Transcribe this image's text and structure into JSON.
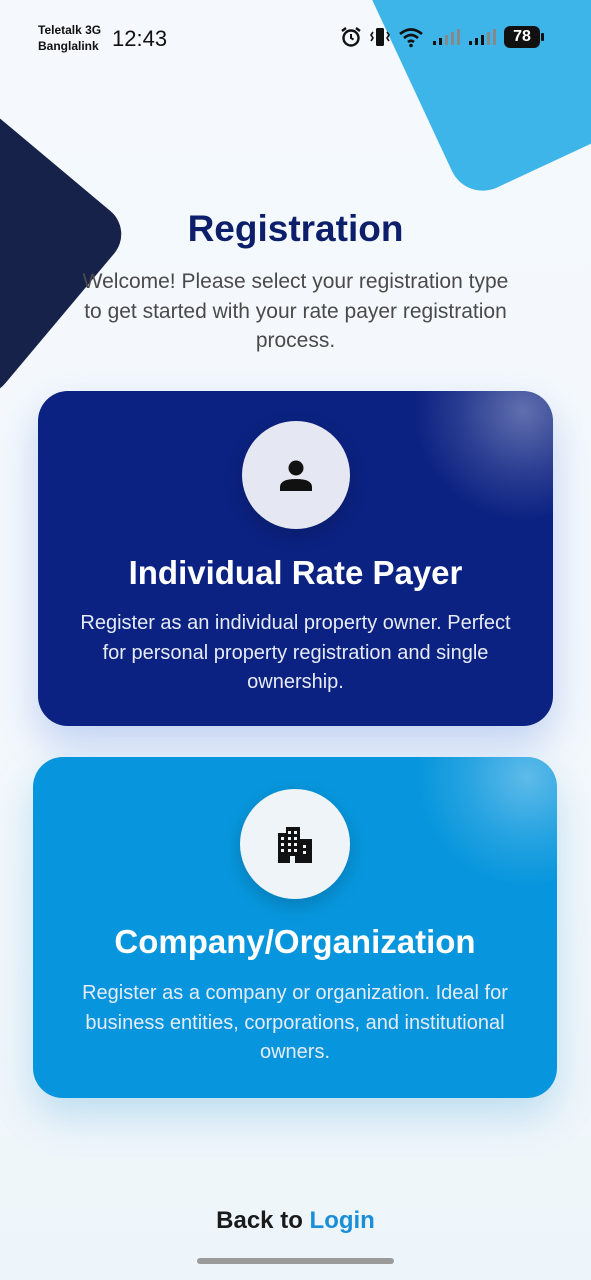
{
  "status_bar": {
    "carrier_line1": "Teletalk 3G",
    "carrier_line2": "Banglalink",
    "time": "12:43",
    "battery": "78",
    "icons": [
      "alarm-icon",
      "vibrate-icon",
      "wifi-icon",
      "signal-icon",
      "signal-icon",
      "battery-icon"
    ]
  },
  "header": {
    "title": "Registration",
    "subtitle": "Welcome! Please select your registration type to get started with your rate payer registration process."
  },
  "options": [
    {
      "icon": "person-icon",
      "title": "Individual Rate Payer",
      "description": "Register as an individual property owner. Perfect for personal property registration and single ownership.",
      "color": "#0c2282"
    },
    {
      "icon": "building-icon",
      "title": "Company/Organization",
      "description": "Register as a company or organization. Ideal for business entities, corporations, and institutional owners.",
      "color": "#0796dd"
    }
  ],
  "footer": {
    "back_prefix": "Back to",
    "login_label": "Login",
    "link_color": "#1a8ed8"
  }
}
